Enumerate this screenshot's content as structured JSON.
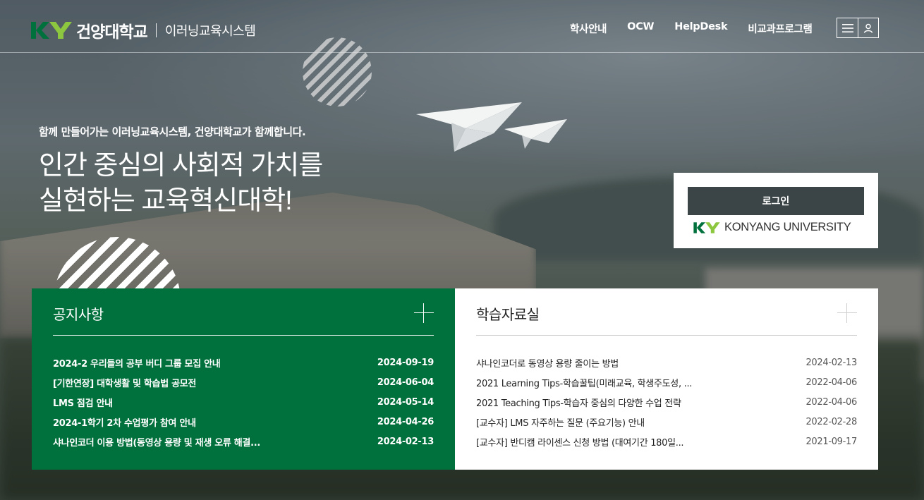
{
  "header": {
    "logo_name": "건양대학교",
    "logo_sub": "이러닝교육시스템",
    "nav": [
      "학사안내",
      "OCW",
      "HelpDesk",
      "비교과프로그램"
    ],
    "icons": [
      "menu-icon",
      "user-icon"
    ]
  },
  "hero": {
    "subtitle": "함께 만들어가는 이러닝교육시스템, 건양대학교가 함께합니다.",
    "title_line1": "인간 중심의 사회적 가치를",
    "title_line2": "실현하는 교육혁신대학!"
  },
  "login": {
    "button_label": "로그인",
    "university_text": "KONYANG UNIVERSITY"
  },
  "notice": {
    "title": "공지사항",
    "items": [
      {
        "title": "2024-2 우리들의 공부 버디 그룹 모집 안내",
        "date": "2024-09-19"
      },
      {
        "title": "[기한연장] 대학생활 및 학습법 공모전",
        "date": "2024-06-04"
      },
      {
        "title": "LMS 점검 안내",
        "date": "2024-05-14"
      },
      {
        "title": "2024-1학기 2차 수업평가 참여 안내",
        "date": "2024-04-26"
      },
      {
        "title": "샤나인코더 이용 방법(동영상 용량 및 재생 오류 해결...",
        "date": "2024-02-13"
      }
    ]
  },
  "archive": {
    "title": "학습자료실",
    "items": [
      {
        "title": "샤나인코더로 동영상 용량 줄이는 방법",
        "date": "2024-02-13"
      },
      {
        "title": "2021 Learning Tips-학습꿀팁(미래교육, 학생주도성, ...",
        "date": "2022-04-06"
      },
      {
        "title": "2021 Teaching Tips-학습자 중심의 다양한 수업 전략",
        "date": "2022-04-06"
      },
      {
        "title": "[교수자] LMS 자주하는 질문 (주요기능) 안내",
        "date": "2022-02-28"
      },
      {
        "title": "[교수자] 반디캠 라이센스 신청 방법 (대여기간 180일...",
        "date": "2021-09-17"
      }
    ]
  },
  "colors": {
    "brand_green": "#00703c",
    "logo_green": "#00a651",
    "login_button": "#3b4547"
  }
}
